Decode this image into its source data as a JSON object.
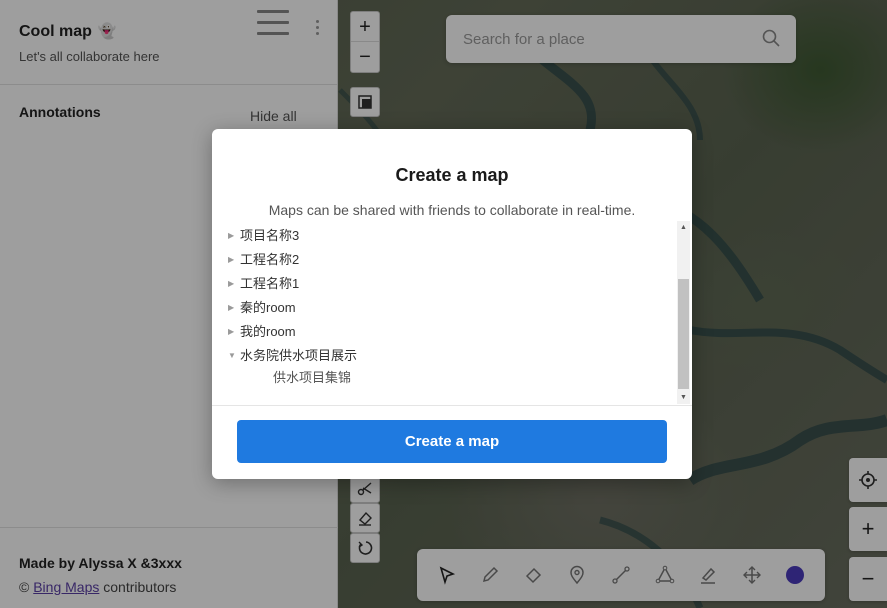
{
  "sidebar": {
    "title": "Cool map",
    "title_emoji": "👻",
    "subtitle": "Let's all collaborate here",
    "annotations_label": "Annotations",
    "hide_all_label": "Hide all",
    "made_by": "Made by Alyssa X &3xxx",
    "credits_prefix": "© ",
    "credits_link": "Bing Maps",
    "credits_suffix": " contributors"
  },
  "map_controls": {
    "zoom_in": "+",
    "zoom_out": "−"
  },
  "search": {
    "placeholder": "Search for a place",
    "value": ""
  },
  "toolbar": {
    "tools": [
      "cursor-icon",
      "pencil-icon",
      "eraser-icon",
      "marker-icon",
      "line-icon",
      "polygon-icon",
      "highlighter-icon",
      "move-icon"
    ],
    "active_color": "#4b3bbd"
  },
  "right_controls": {
    "locate": "locate-icon",
    "zoom_in": "+",
    "zoom_out": "−"
  },
  "modal": {
    "title": "Create a map",
    "description": "Maps can be shared with friends to collaborate in real-time.",
    "items": [
      {
        "label": "项目名称3",
        "expanded": false
      },
      {
        "label": "工程名称2",
        "expanded": false
      },
      {
        "label": "工程名称1",
        "expanded": false
      },
      {
        "label": "秦的room",
        "expanded": false
      },
      {
        "label": "我的room",
        "expanded": false
      },
      {
        "label": "水务院供水项目展示",
        "expanded": true
      }
    ],
    "sub_item": "供水项目集锦",
    "button_label": "Create a map"
  }
}
